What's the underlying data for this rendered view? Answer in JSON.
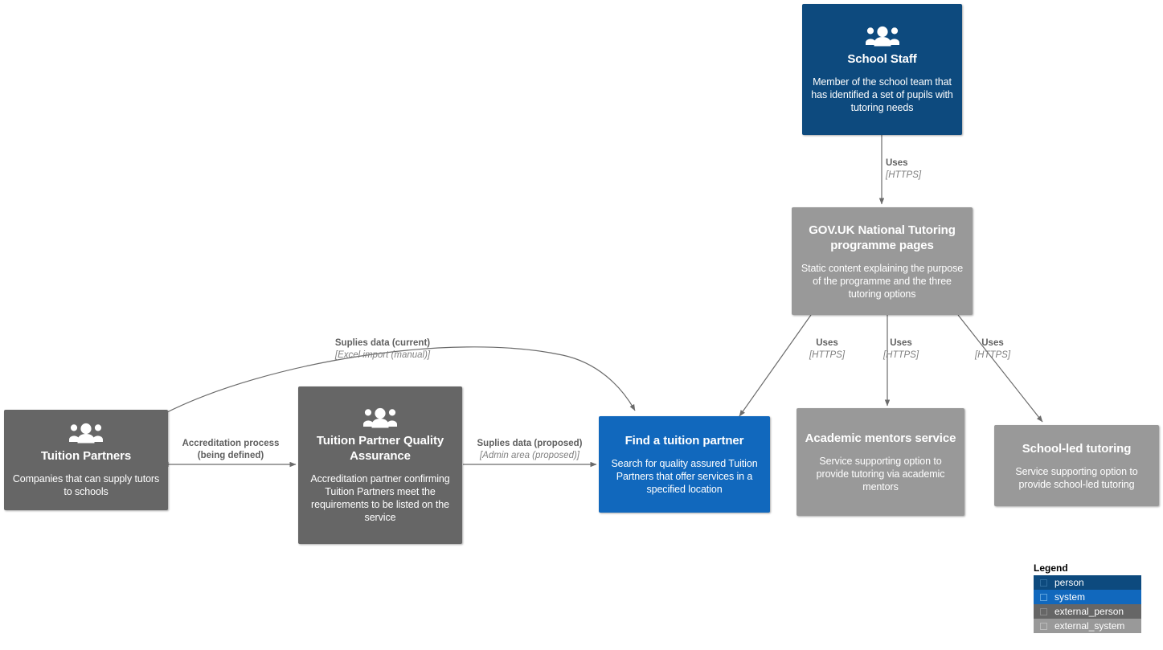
{
  "diagram": {
    "nodes": [
      {
        "id": "school-staff",
        "title": "School Staff",
        "desc": "Member of the school team that has identified a set of pupils with tutoring needs",
        "kind": "person",
        "icon": "people-icon",
        "color": "#0d4a7e"
      },
      {
        "id": "govuk-ntp-pages",
        "title": "GOV.UK National Tutoring programme pages",
        "desc": "Static content explaining the purpose of the programme and the three tutoring options",
        "kind": "external_system",
        "icon": "none",
        "color": "#999999"
      },
      {
        "id": "tuition-partners",
        "title": "Tuition Partners",
        "desc": "Companies that can supply tutors to schools",
        "kind": "external_person",
        "icon": "people-icon",
        "color": "#666666"
      },
      {
        "id": "tp-quality-assurance",
        "title": "Tuition Partner Quality Assurance",
        "desc": "Accreditation partner confirming Tuition Partners meet the requirements to be listed on the service",
        "kind": "external_person",
        "icon": "people-icon",
        "color": "#666666"
      },
      {
        "id": "find-a-tuition-partner",
        "title": "Find a tuition partner",
        "desc": "Search for quality assured Tuition Partners that offer services in a specified location",
        "kind": "system",
        "icon": "none",
        "color": "#1168bd"
      },
      {
        "id": "academic-mentors-service",
        "title": "Academic mentors service",
        "desc": "Service supporting option to provide tutoring via academic mentors",
        "kind": "external_system",
        "icon": "none",
        "color": "#999999"
      },
      {
        "id": "school-led-tutoring",
        "title": "School-led tutoring",
        "desc": "Service supporting option to provide school-led tutoring",
        "kind": "external_system",
        "icon": "none",
        "color": "#999999"
      }
    ],
    "edges": [
      {
        "id": "staff-to-govuk",
        "label": "Uses",
        "tech": "[HTTPS]"
      },
      {
        "id": "govuk-to-find",
        "label": "Uses",
        "tech": "[HTTPS]"
      },
      {
        "id": "govuk-to-mentors",
        "label": "Uses",
        "tech": "[HTTPS]"
      },
      {
        "id": "govuk-to-schoolled",
        "label": "Uses",
        "tech": "[HTTPS]"
      },
      {
        "id": "tp-to-find",
        "label": "Suplies data (current)",
        "tech": "[Excel import (manual)]"
      },
      {
        "id": "tp-to-qa",
        "label": "Accreditation process",
        "tech": "(being defined)"
      },
      {
        "id": "qa-to-find",
        "label": "Suplies data (proposed)",
        "tech": "[Admin area (proposed)]"
      }
    ]
  },
  "legend": {
    "title": "Legend",
    "items": [
      {
        "label": "person",
        "color": "#0d4a7e"
      },
      {
        "label": "system",
        "color": "#1168bd"
      },
      {
        "label": "external_person",
        "color": "#666666"
      },
      {
        "label": "external_system",
        "color": "#999999"
      }
    ]
  }
}
